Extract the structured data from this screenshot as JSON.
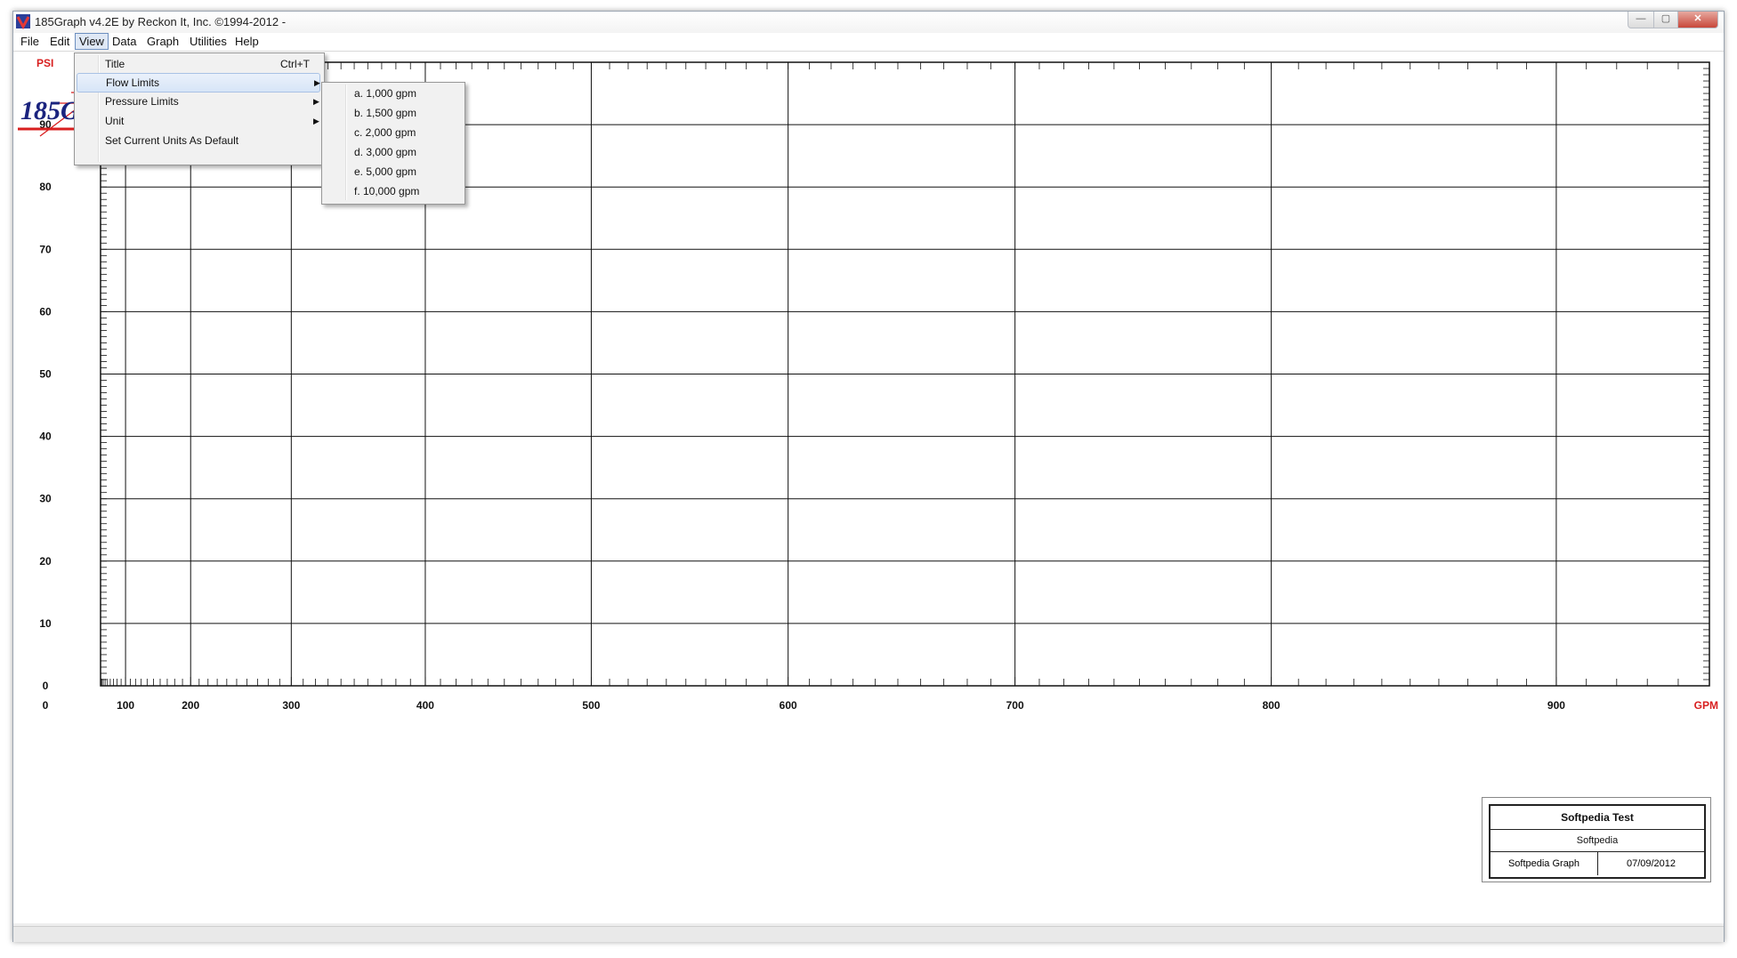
{
  "window": {
    "title": "185Graph v4.2E by Reckon It, Inc. ©1994-2012 -",
    "controls": {
      "minimize": "—",
      "maximize": "▢",
      "close": "✕"
    }
  },
  "menubar": {
    "items": [
      "File",
      "Edit",
      "View",
      "Data",
      "Graph",
      "Utilities",
      "Help"
    ],
    "open_menu": "View"
  },
  "view_menu": {
    "items": [
      {
        "label": "Title",
        "accel": "Ctrl+T"
      },
      {
        "label": "Flow Limits",
        "submenu": true,
        "highlighted": true
      },
      {
        "label": "Pressure Limits",
        "submenu": true
      },
      {
        "label": "Unit",
        "submenu": true
      },
      {
        "label": "Set Current Units As Default"
      }
    ]
  },
  "flow_limits_submenu": {
    "items": [
      "a. 1,000 gpm",
      "b. 1,500 gpm",
      "c. 2,000 gpm",
      "d. 3,000 gpm",
      "e. 5,000 gpm",
      "f. 10,000 gpm"
    ]
  },
  "logo": {
    "text": "185Graph",
    "color": "#1a237e",
    "accent": "#d81f1f"
  },
  "title_block": {
    "title": "Softpedia Test",
    "subtitle": "Softpedia",
    "name": "Softpedia Graph",
    "date": "07/09/2012"
  },
  "chart_data": {
    "type": "line",
    "x_axis": {
      "unit": "GPM",
      "scale": "N^1.85",
      "tick_labels": [
        "0",
        "100",
        "200",
        "300",
        "400",
        "500",
        "600",
        "700",
        "800",
        "900"
      ],
      "range": [
        0,
        950
      ]
    },
    "y_axis": {
      "unit": "PSI",
      "tick_labels": [
        "0",
        "10",
        "20",
        "30",
        "40",
        "50",
        "60",
        "70",
        "80",
        "90"
      ],
      "range": [
        0,
        100
      ]
    },
    "series": [],
    "grid": true
  },
  "colors": {
    "unit_label": "#d81f1f",
    "grid": "#111111"
  }
}
